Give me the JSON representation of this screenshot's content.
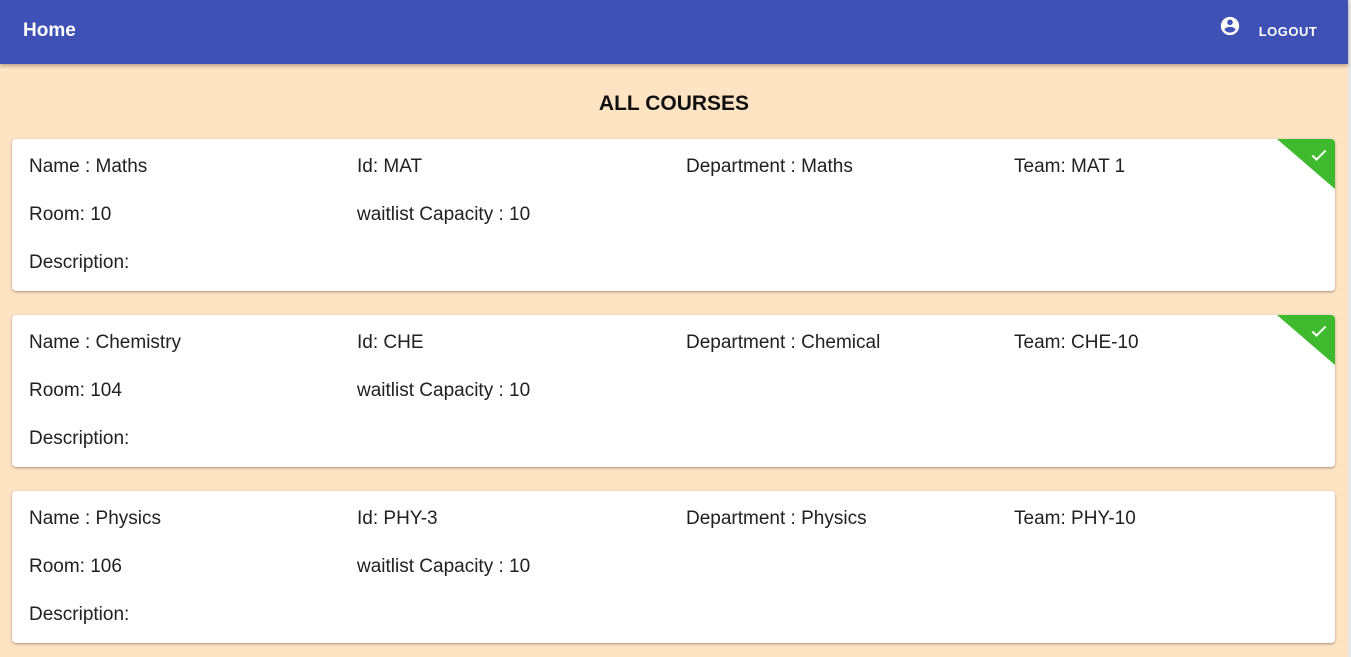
{
  "appbar": {
    "title": "Home",
    "account_icon": "account-circle-icon",
    "logout_label": "LOGOUT",
    "color": "#3f51b5"
  },
  "page": {
    "title": "ALL COURSES",
    "background": "#ffe4c4"
  },
  "courses": [
    {
      "name": "Name : Maths",
      "id": "Id: MAT",
      "department": "Department : Maths",
      "team": "Team: MAT 1",
      "room": "Room: 10",
      "waitlist": "waitlist Capacity : 10",
      "description": "Description:",
      "status_icon": "check-icon"
    },
    {
      "name": "Name : Chemistry",
      "id": "Id: CHE",
      "department": "Department : Chemical",
      "team": "Team: CHE-10",
      "room": "Room: 104",
      "waitlist": "waitlist Capacity : 10",
      "description": "Description:",
      "status_icon": "check-icon"
    },
    {
      "name": "Name : Physics",
      "id": "Id: PHY-3",
      "department": "Department : Physics",
      "team": "Team: PHY-10",
      "room": "Room: 106",
      "waitlist": "waitlist Capacity : 10",
      "description": "Description:"
    }
  ],
  "colors": {
    "enrolled_ribbon": "#3fba2e"
  }
}
